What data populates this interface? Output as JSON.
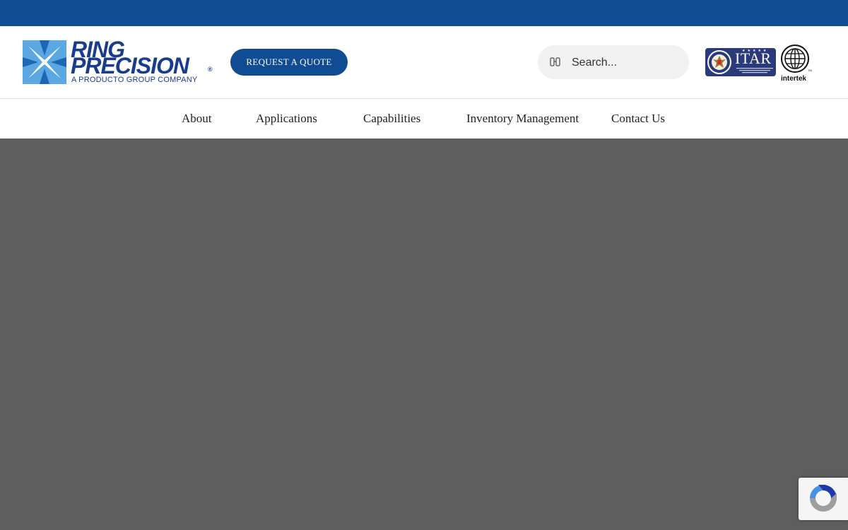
{
  "brand": {
    "name_line1": "RING",
    "name_line2": "PRECISION",
    "registered": "®",
    "tagline": "A PRODUCTO GROUP COMPANY",
    "color": "#1a3c8f"
  },
  "header": {
    "quote_button": "REQUEST A QUOTE",
    "search_placeholder": "Search...",
    "itar_label": "ITAR",
    "intertek_label": "intertek"
  },
  "nav": {
    "items": [
      {
        "label": "About"
      },
      {
        "label": "Applications"
      },
      {
        "label": "Capabilities"
      },
      {
        "label": "Inventory Management"
      },
      {
        "label": "Contact Us"
      }
    ]
  },
  "icons": {
    "search": "search-icon",
    "recaptcha": "recaptcha-icon"
  },
  "colors": {
    "topbar": "#0f4c92",
    "button": "#0f4c92",
    "overlay": "#5e5e5e"
  }
}
